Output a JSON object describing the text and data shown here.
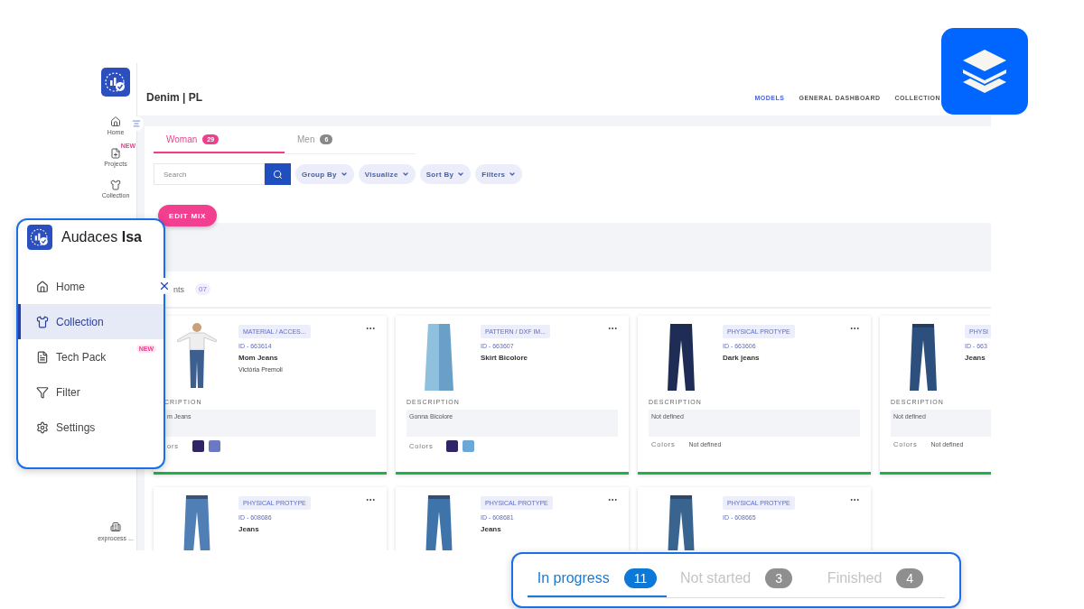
{
  "rail": {
    "items": [
      {
        "label": "Home"
      },
      {
        "label": "Projects",
        "badge": "NEW"
      },
      {
        "label": "Collection"
      }
    ],
    "footer": "exprocess ..."
  },
  "header": {
    "title": "Denim | PL",
    "nav": [
      {
        "label": "MODELS",
        "selected": true
      },
      {
        "label": "GENERAL DASHBOARD",
        "selected": false
      },
      {
        "label": "COLLECTION",
        "selected": false
      }
    ]
  },
  "category_tabs": [
    {
      "label": "Woman",
      "count": "29",
      "selected": true
    },
    {
      "label": "Men",
      "count": "6",
      "selected": false
    }
  ],
  "search": {
    "placeholder": "Search"
  },
  "toolbar_menus": [
    "Group By",
    "Visualize",
    "Sort By",
    "Filters"
  ],
  "edit_mix_button": "EDIT MIX",
  "section": {
    "label": "nts",
    "count": "07"
  },
  "cards": [
    {
      "type": "MATERIAL / ACCES...",
      "id": "ID - 663614",
      "name": "Mom Jeans",
      "more_menu": true,
      "author": "Victória Premoli",
      "description_label": "CRIPTION",
      "description": "m Jeans",
      "colors_label": "ors",
      "colors": [
        {
          "color": "#2e2466"
        },
        {
          "color": "#6b78c4"
        }
      ]
    },
    {
      "type": "PATTERN / DXF IM...",
      "id": "ID - 663607",
      "name": "Skirt Bicolore",
      "more_menu": true,
      "description_label": "DESCRIPTION",
      "description": "Gonna Bicolore",
      "colors_label": "Colors",
      "colors": [
        {
          "color": "#2e2466"
        },
        {
          "color": "#6aa8d8"
        }
      ]
    },
    {
      "type": "PHYSICAL PROTYPE",
      "id": "ID - 663606",
      "name": "Dark jeans",
      "more_menu": true,
      "description_label": "DESCRIPTION",
      "description": "Not defined",
      "colors_label": "Colors",
      "colors_text": "Not defined"
    },
    {
      "type": "PHYSI",
      "id": "ID - 663",
      "name": "Jeans",
      "description_label": "DESCRIPTION",
      "description": "Not defined",
      "colors_label": "Colors",
      "colors_text": "Not defined"
    },
    {
      "type": "PHYSICAL PROTYPE",
      "id": "ID - 608686",
      "name": "Jeans",
      "more_menu": true
    },
    {
      "type": "PHYSICAL PROTYPE",
      "id": "ID - 608681",
      "name": "Jeans",
      "more_menu": true
    },
    {
      "type": "PHYSICAL PROTYPE",
      "id": "ID - 608665",
      "more_menu": true
    }
  ],
  "isa_menu": {
    "brand": "Audaces",
    "brand_bold": "Isa",
    "items": [
      {
        "label": "Home",
        "selected": false
      },
      {
        "label": "Collection",
        "selected": true
      },
      {
        "label": "Tech Pack",
        "selected": false,
        "badge": "NEW"
      },
      {
        "label": "Filter",
        "selected": false
      },
      {
        "label": "Settings",
        "selected": false
      }
    ]
  },
  "status_tabs": [
    {
      "label": "In progress",
      "count": "11",
      "selected": true
    },
    {
      "label": "Not started",
      "count": "3",
      "selected": false
    },
    {
      "label": "Finished",
      "count": "4",
      "selected": false
    }
  ]
}
